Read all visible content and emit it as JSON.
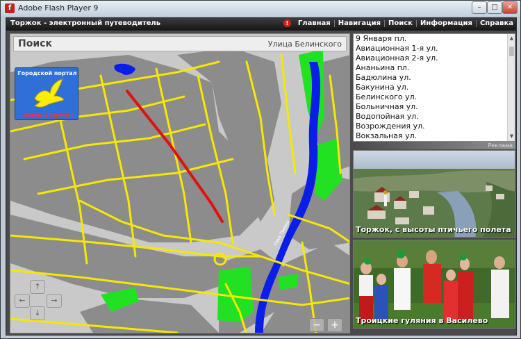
{
  "window": {
    "title": "Adobe Flash Player 9",
    "app_icon_glyph": "f",
    "min_glyph": "–",
    "max_glyph": "□",
    "close_glyph": "✕"
  },
  "app": {
    "title": "Торжок - электронный путеводитель",
    "alert_glyph": "!",
    "nav": [
      {
        "label": "Главная"
      },
      {
        "label": "Навигация"
      },
      {
        "label": "Поиск"
      },
      {
        "label": "Информация"
      },
      {
        "label": "Справка"
      }
    ]
  },
  "map": {
    "title": "Поиск",
    "selected_street": "Улица Белинского",
    "river_label": "Река Тверца",
    "colors": {
      "land": "#c9c9c9",
      "block": "#8c8c8c",
      "road": "#f5e900",
      "water": "#0a1ee8",
      "park": "#22e022",
      "route": "#e01010"
    },
    "pan": {
      "up": "↑",
      "down": "↓",
      "left": "←",
      "right": "→"
    },
    "zoom": {
      "out": "−",
      "in": "+"
    }
  },
  "portal": {
    "top_text": "Городской портал",
    "bottom_text": "«Жизнь в Торжке»"
  },
  "streets": [
    "9 Января пл.",
    "Авиационная 1-я ул.",
    "Авиационная 2-я ул.",
    "Ананьина пл.",
    "Бадюлина ул.",
    "Бакунина ул.",
    "Белинского ул.",
    "Больничная ул.",
    "Водопойная ул.",
    "Возрождения ул.",
    "Вокзальная ул."
  ],
  "scroll": {
    "up": "▲",
    "down": "▼"
  },
  "ad_label": "Реклама",
  "photos": [
    {
      "caption": "Торжок, с высоты птичьего полета"
    },
    {
      "caption": "Троицкие гуляния в Василево"
    }
  ]
}
